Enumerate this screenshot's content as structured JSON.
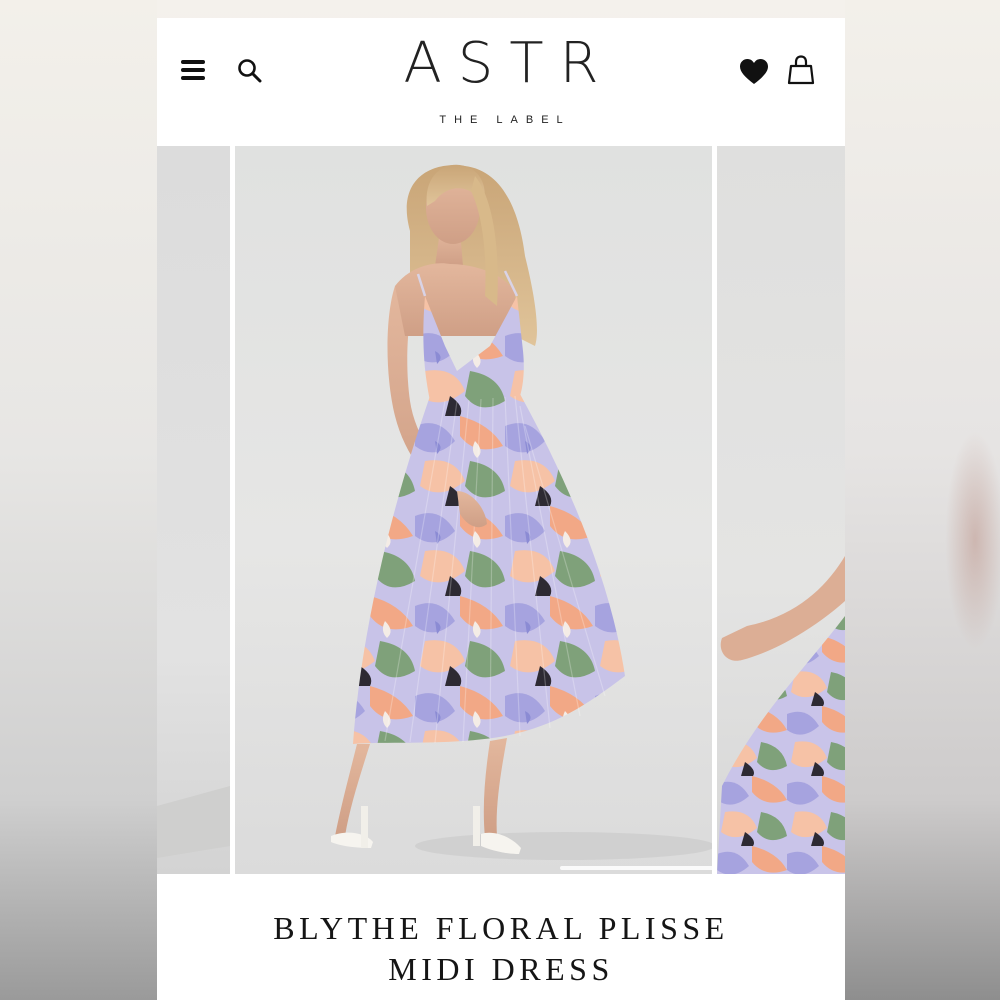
{
  "header": {
    "brand_name": "ASTR",
    "brand_tagline": "THE LABEL",
    "icons": {
      "menu": "hamburger-menu-icon",
      "search": "search-icon",
      "wishlist": "heart-icon",
      "cart": "shopping-bag-icon"
    }
  },
  "gallery": {
    "slide_count_visible": 3
  },
  "product": {
    "title_line1": "BLYTHE FLORAL PLISSE",
    "title_line2": "MIDI DRESS"
  },
  "colors": {
    "text": "#151515",
    "background": "#ffffff",
    "dress_lavender": "#a9a8e0",
    "dress_peach": "#f2a886",
    "dress_green": "#7fa17a"
  }
}
